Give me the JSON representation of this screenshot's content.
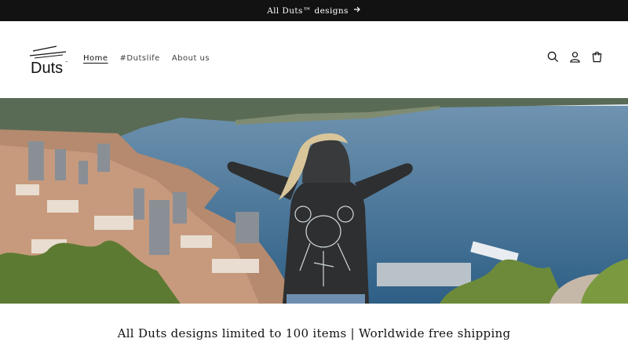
{
  "announcement": {
    "text": "All Duts™ designs"
  },
  "header": {
    "logo_text": "Duts",
    "nav": [
      {
        "label": "Home",
        "active": true
      },
      {
        "label": "#Dutslife",
        "active": false
      },
      {
        "label": "About us",
        "active": false
      }
    ],
    "icons": [
      "search-icon",
      "account-icon",
      "cart-icon"
    ]
  },
  "hero": {
    "description": "",
    "colors": {
      "sea": "#3d6f93",
      "sky": "#dfe7ee",
      "hoodie": "#2e2f30",
      "hair": "#d8c59a",
      "foliage": "#6d8a3a"
    }
  },
  "tagline": "All Duts designs limited to 100 items | Worldwide free shipping"
}
